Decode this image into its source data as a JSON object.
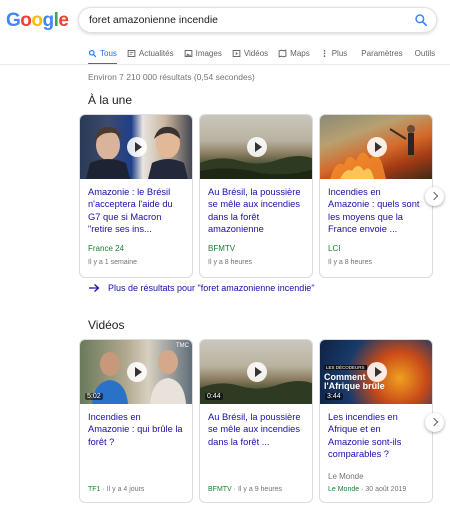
{
  "logo": "Google",
  "search": {
    "query": "foret amazonienne incendie"
  },
  "tabs": [
    {
      "label": "Tous",
      "active": true
    },
    {
      "label": "Actualités"
    },
    {
      "label": "Images"
    },
    {
      "label": "Vidéos"
    },
    {
      "label": "Maps"
    },
    {
      "label": "Plus"
    },
    {
      "label": "Paramètres"
    },
    {
      "label": "Outils"
    }
  ],
  "result_stats": "Environ 7 210 000 résultats (0,54 secondes)",
  "top_stories": {
    "title": "À la une",
    "cards": [
      {
        "title": "Amazonie : le Brésil n'acceptera l'aide du G7 que si Macron \"retire ses ins...",
        "source": "France 24",
        "time": "Il y a 1 semaine"
      },
      {
        "title": "Au Brésil, la poussière se mêle aux incendies dans la forêt amazonienne",
        "source": "BFMTV",
        "time": "Il y a 8 heures"
      },
      {
        "title": "Incendies en Amazonie : quels sont les moyens que la France envoie ...",
        "source": "LCI",
        "time": "Il y a 8 heures"
      }
    ],
    "more_link": "Plus de résultats pour \"foret amazonienne incendie\""
  },
  "videos": {
    "title": "Vidéos",
    "cards": [
      {
        "title": "Incendies en Amazonie : qui brûle la forêt ?",
        "duration": "5:02",
        "channel_badge": "TMC",
        "source": "TF1",
        "time": "Il y a 4 jours"
      },
      {
        "title": "Au Brésil, la poussière se mêle aux incendies dans la forêt ...",
        "duration": "0:44",
        "source": "BFMTV",
        "time": "Il y a 9 heures"
      },
      {
        "title": "Les incendies en Afrique et en Amazonie sont-ils comparables ?",
        "duration": "3:44",
        "overlay_title": "Comment l'Afrique brûle",
        "overlay_badge": "LES DÉCODEURS",
        "publisher": "Le Monde",
        "source": "Le Monde",
        "time": "30 août 2019"
      }
    ]
  },
  "colors": {
    "link": "#1a0dab",
    "source": "#188038",
    "accent": "#1a73e8",
    "meta": "#70757a"
  }
}
